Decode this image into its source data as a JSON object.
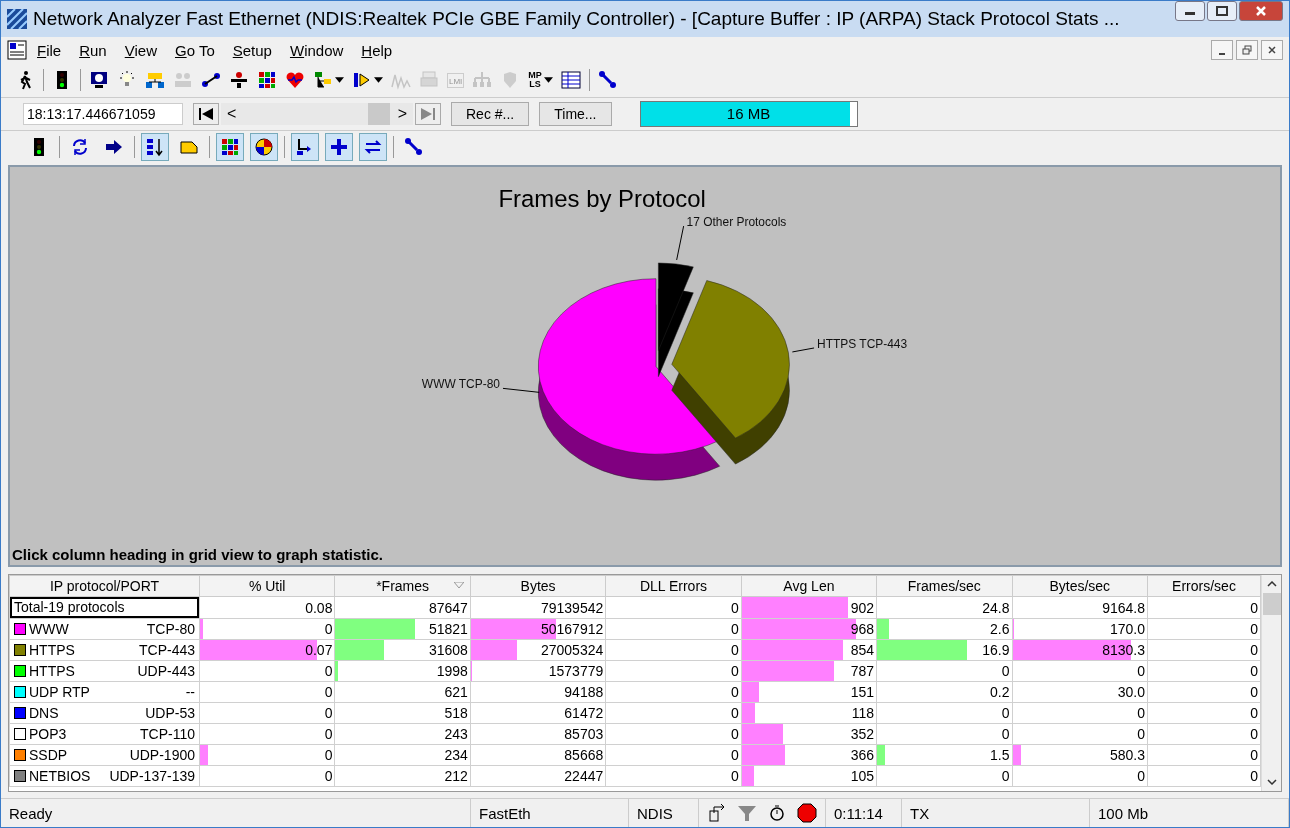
{
  "window": {
    "title": "Network Analyzer Fast Ethernet (NDIS:Realtek PCIe GBE Family Controller) - [Capture Buffer : IP (ARPA) Stack Protocol Stats ..."
  },
  "menu": [
    "File",
    "Run",
    "View",
    "Go To",
    "Setup",
    "Window",
    "Help"
  ],
  "toolbar_1": {
    "lmi_label": "LMI",
    "mpls_label": [
      "MP",
      "LS"
    ]
  },
  "navigation": {
    "time_value": "18:13:17.446671059",
    "prev": "<",
    "next": ">",
    "rec_button": "Rec #...",
    "time_button": "Time...",
    "buffer": {
      "text": "16 MB",
      "level": 0.97
    }
  },
  "toolbar_3": [
    {
      "pressed": false
    },
    {
      "pressed": false
    },
    {
      "pressed": false
    },
    {
      "pressed": true
    },
    {
      "pressed": false
    },
    {
      "pressed": true
    },
    {
      "pressed": true
    },
    {
      "pressed": true
    },
    {
      "pressed": true
    },
    {
      "pressed": true
    },
    {
      "pressed": false
    }
  ],
  "chart": {
    "title": "Frames by Protocol",
    "slice_labels": [
      "WWW TCP-80",
      "HTTPS TCP-443",
      "17 Other Protocols"
    ],
    "hint": "Click column heading in grid view to graph statistic."
  },
  "table": {
    "columns": [
      {
        "label": "IP protocol/PORT"
      },
      {
        "label": "% Util"
      },
      {
        "label": "*Frames",
        "sorted": true
      },
      {
        "label": "Bytes"
      },
      {
        "label": "DLL Errors"
      },
      {
        "label": "Avg Len"
      },
      {
        "label": "Frames/sec"
      },
      {
        "label": "Bytes/sec"
      },
      {
        "label": "Errors/sec"
      }
    ],
    "rows": [
      {
        "cells": [
          {
            "text": "Total-19 protocols",
            "focused": true
          },
          {
            "text": "0.08"
          },
          {
            "text": "87647"
          },
          {
            "text": "79139542"
          },
          {
            "text": "0"
          },
          {
            "text": "902",
            "level": 0.79,
            "color": "#ff80ff"
          },
          {
            "text": "24.8"
          },
          {
            "text": "9164.8"
          },
          {
            "text": "0"
          }
        ]
      },
      {
        "cells": [
          {
            "text": "WWW",
            "port": "TCP-80",
            "color": "#ff00ff"
          },
          {
            "text": "0",
            "level": 0.02,
            "color": "#ff80ff"
          },
          {
            "text": "51821",
            "level": 0.59,
            "color": "#80ff80"
          },
          {
            "text": "50167912",
            "level": 0.63,
            "color": "#ff80ff"
          },
          {
            "text": "0"
          },
          {
            "text": "968",
            "level": 0.85,
            "color": "#ff80ff"
          },
          {
            "text": "2.6",
            "level": 0.09,
            "color": "#80ff80"
          },
          {
            "text": "170.0",
            "level": 0.01,
            "color": "#ff80ff"
          },
          {
            "text": "0"
          }
        ]
      },
      {
        "cells": [
          {
            "text": "HTTPS",
            "port": "TCP-443",
            "color": "#808000"
          },
          {
            "text": "0.07",
            "level": 0.87,
            "color": "#ff80ff"
          },
          {
            "text": "31608",
            "level": 0.36,
            "color": "#80ff80"
          },
          {
            "text": "27005324",
            "level": 0.34,
            "color": "#ff80ff"
          },
          {
            "text": "0"
          },
          {
            "text": "854",
            "level": 0.75,
            "color": "#ff80ff"
          },
          {
            "text": "16.9",
            "level": 0.67,
            "color": "#80ff80"
          },
          {
            "text": "8130.3",
            "level": 0.88,
            "color": "#ff80ff"
          },
          {
            "text": "0"
          }
        ]
      },
      {
        "cells": [
          {
            "text": "HTTPS",
            "port": "UDP-443",
            "color": "#00ff00"
          },
          {
            "text": "0"
          },
          {
            "text": "1998",
            "level": 0.02,
            "color": "#80ff80"
          },
          {
            "text": "1573779",
            "level": 0.01,
            "color": "#ff80ff"
          },
          {
            "text": "0"
          },
          {
            "text": "787",
            "level": 0.69,
            "color": "#ff80ff"
          },
          {
            "text": "0"
          },
          {
            "text": "0"
          },
          {
            "text": "0"
          }
        ]
      },
      {
        "cells": [
          {
            "text": "UDP RTP",
            "port": "--",
            "color": "#00ffff"
          },
          {
            "text": "0"
          },
          {
            "text": "621"
          },
          {
            "text": "94188"
          },
          {
            "text": "0"
          },
          {
            "text": "151",
            "level": 0.13,
            "color": "#ff80ff"
          },
          {
            "text": "0.2"
          },
          {
            "text": "30.0"
          },
          {
            "text": "0"
          }
        ]
      },
      {
        "cells": [
          {
            "text": "DNS",
            "port": "UDP-53",
            "color": "#0000ff"
          },
          {
            "text": "0"
          },
          {
            "text": "518"
          },
          {
            "text": "61472"
          },
          {
            "text": "0"
          },
          {
            "text": "118",
            "level": 0.1,
            "color": "#ff80ff"
          },
          {
            "text": "0"
          },
          {
            "text": "0"
          },
          {
            "text": "0"
          }
        ]
      },
      {
        "cells": [
          {
            "text": "POP3",
            "port": "TCP-110",
            "color": "#ffffff"
          },
          {
            "text": "0"
          },
          {
            "text": "243"
          },
          {
            "text": "85703"
          },
          {
            "text": "0"
          },
          {
            "text": "352",
            "level": 0.31,
            "color": "#ff80ff"
          },
          {
            "text": "0"
          },
          {
            "text": "0"
          },
          {
            "text": "0"
          }
        ]
      },
      {
        "cells": [
          {
            "text": "SSDP",
            "port": "UDP-1900",
            "color": "#ff8000"
          },
          {
            "text": "0",
            "level": 0.06,
            "color": "#ff80ff"
          },
          {
            "text": "234"
          },
          {
            "text": "85668"
          },
          {
            "text": "0"
          },
          {
            "text": "366",
            "level": 0.32,
            "color": "#ff80ff"
          },
          {
            "text": "1.5",
            "level": 0.06,
            "color": "#80ff80"
          },
          {
            "text": "580.3",
            "level": 0.06,
            "color": "#ff80ff"
          },
          {
            "text": "0"
          }
        ]
      },
      {
        "cells": [
          {
            "text": "NETBIOS",
            "port": "UDP-137-139",
            "color": "#808080"
          },
          {
            "text": "0"
          },
          {
            "text": "212"
          },
          {
            "text": "22447"
          },
          {
            "text": "0"
          },
          {
            "text": "105",
            "level": 0.09,
            "color": "#ff80ff"
          },
          {
            "text": "0"
          },
          {
            "text": "0"
          },
          {
            "text": "0"
          }
        ]
      }
    ]
  },
  "status_bar": {
    "message": "Ready",
    "adapter": "FastEth",
    "driver": "NDIS",
    "elapsed": "0:11:14",
    "mode": "TX",
    "speed": "100 Mb"
  }
}
